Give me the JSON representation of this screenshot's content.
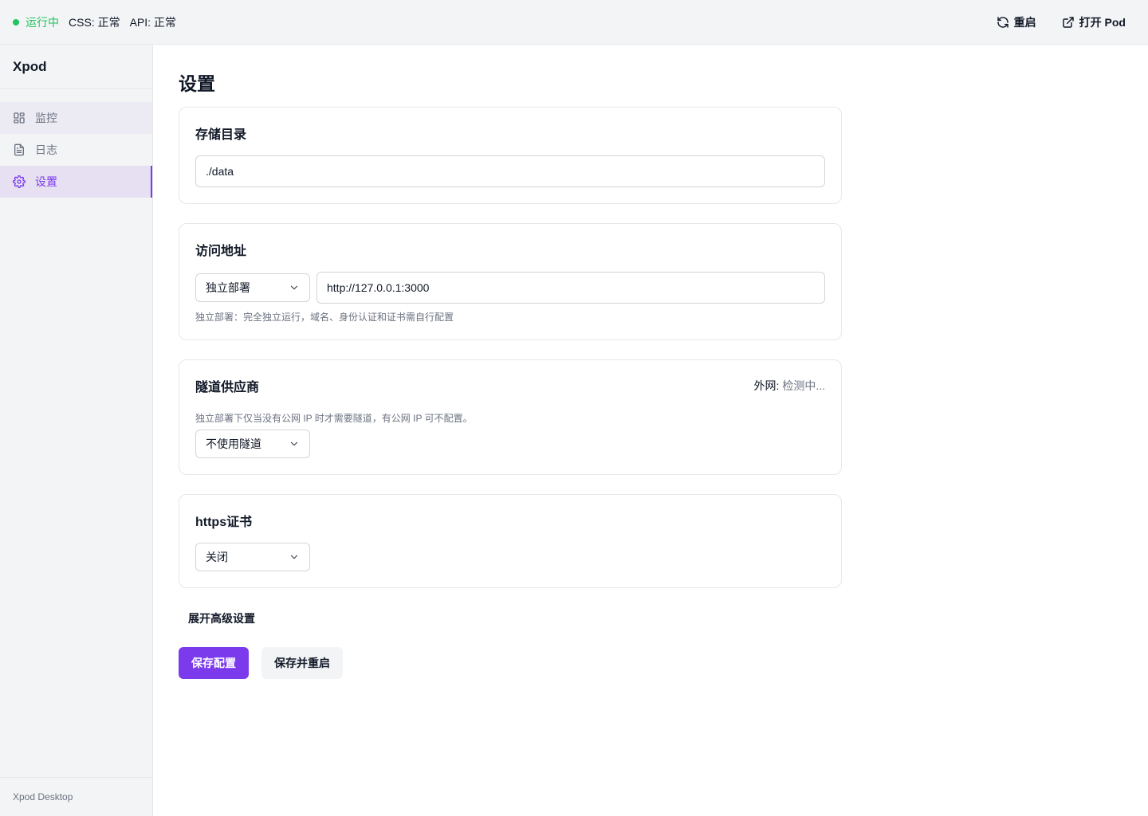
{
  "colors": {
    "accent": "#7c3aed",
    "status_ok": "#22c55e",
    "muted": "#6b7280"
  },
  "header": {
    "status_running": "运行中",
    "css_status": "CSS: 正常",
    "api_status": "API: 正常",
    "restart_label": "重启",
    "restart_icon": "refresh-icon",
    "open_pod_label": "打开 Pod",
    "open_pod_icon": "external-link-icon"
  },
  "sidebar": {
    "brand": "Xpod",
    "items": [
      {
        "label": "监控",
        "icon": "dashboard-icon",
        "state": "hover"
      },
      {
        "label": "日志",
        "icon": "file-text-icon",
        "state": "normal"
      },
      {
        "label": "设置",
        "icon": "gear-icon",
        "state": "active"
      }
    ],
    "footer": "Xpod Desktop"
  },
  "main": {
    "title": "设置",
    "storage": {
      "title": "存储目录",
      "value": "./data"
    },
    "access": {
      "title": "访问地址",
      "mode": "独立部署",
      "url": "http://127.0.0.1:3000",
      "hint": "独立部署：完全独立运行，域名、身份认证和证书需自行配置"
    },
    "tunnel": {
      "title": "隧道供应商",
      "net_label": "外网:",
      "net_value": "检测中...",
      "hint": "独立部署下仅当没有公网 IP 时才需要隧道，有公网 IP 可不配置。",
      "provider": "不使用隧道"
    },
    "https": {
      "title": "https证书",
      "value": "关闭"
    },
    "advanced_label": "展开高级设置",
    "save_label": "保存配置",
    "save_restart_label": "保存并重启"
  }
}
